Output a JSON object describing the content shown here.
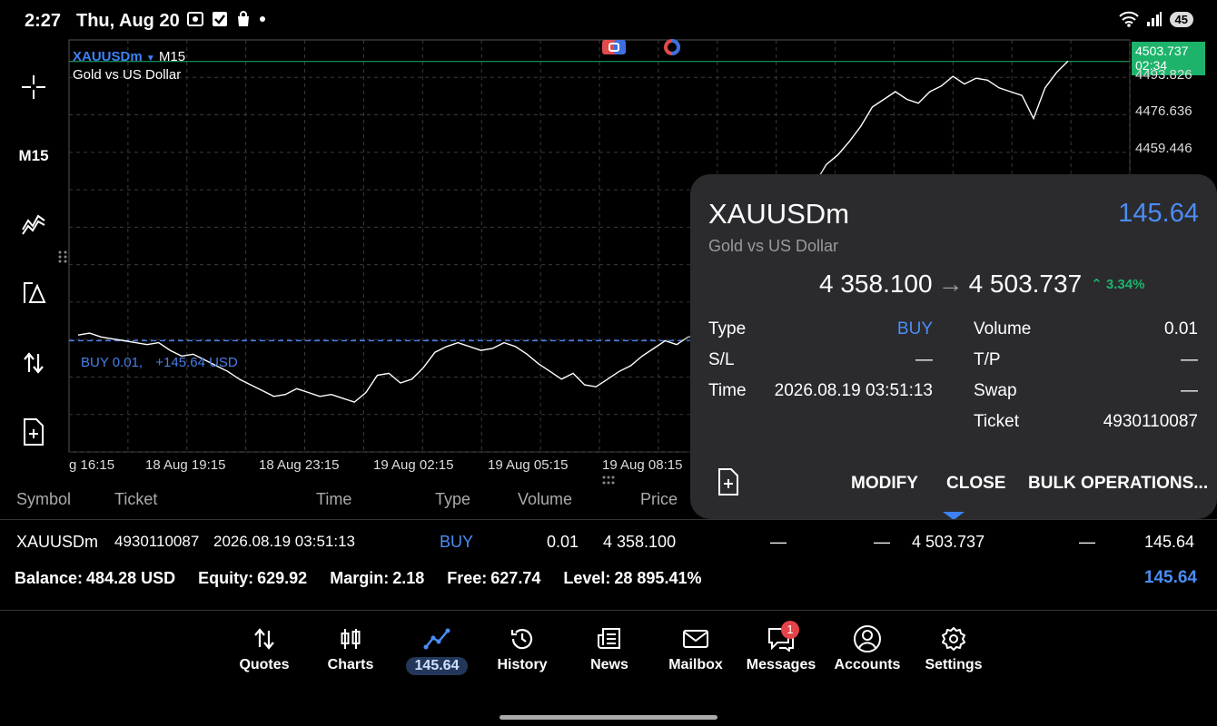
{
  "status_bar": {
    "time": "2:27",
    "date": "Thu, Aug 20",
    "battery": "45"
  },
  "left_toolbar": {
    "timeframe": "M15"
  },
  "chart": {
    "symbol": "XAUUSDm",
    "timeframe": "M15",
    "description": "Gold vs US Dollar",
    "price_tag_price": "4503.737",
    "price_tag_time": "02:34",
    "trade_line_label": "BUY 0.01,",
    "trade_line_profit": "+145.64 USD",
    "colors": {
      "line": "#ffffff",
      "trade_line": "#4a7ee8",
      "price_tag": "#1db36b",
      "grid": "#3a3a3a"
    }
  },
  "chart_data": {
    "type": "line",
    "title": "XAUUSDm M15",
    "subtitle": "Gold vs US Dollar",
    "x_tick_labels": [
      "g 16:15",
      "18 Aug 19:15",
      "18 Aug 23:15",
      "19 Aug 02:15",
      "19 Aug 05:15",
      "19 Aug 08:15"
    ],
    "y_tick_labels": [
      "4493.826",
      "4476.636",
      "4459.446"
    ],
    "current_price": 4503.737,
    "trade_open_price": 4358.1,
    "series": [
      {
        "values": [
          4361,
          4362,
          4360,
          4359,
          4358,
          4357,
          4356,
          4357,
          4353,
          4350,
          4351,
          4348,
          4345,
          4342,
          4338,
          4335,
          4332,
          4329,
          4330,
          4333,
          4331,
          4329,
          4330,
          4328,
          4326,
          4331,
          4340,
          4341,
          4336,
          4338,
          4344,
          4352,
          4355,
          4357,
          4355,
          4353,
          4354,
          4357,
          4355,
          4351,
          4346,
          4342,
          4338,
          4341,
          4335,
          4334,
          4338,
          4342,
          4345,
          4350,
          4354,
          4358,
          4356,
          4360,
          4361,
          4362,
          4358,
          4359,
          4362,
          4368,
          4380,
          4395,
          4410,
          4425,
          4440,
          4450,
          4455,
          4462,
          4470,
          4480,
          4484,
          4488,
          4484,
          4482,
          4488,
          4491,
          4496,
          4492,
          4495,
          4494,
          4490,
          4488,
          4486,
          4474,
          4490,
          4498,
          4504
        ]
      }
    ]
  },
  "popup": {
    "symbol": "XAUUSDm",
    "description": "Gold vs US Dollar",
    "profit": "145.64",
    "open_price": "4 358.100",
    "current_price": "4 503.737",
    "change_pct": "3.34%",
    "type_label": "Type",
    "type_value": "BUY",
    "sl_label": "S/L",
    "sl_value": "—",
    "time_label": "Time",
    "time_value": "2026.08.19 03:51:13",
    "volume_label": "Volume",
    "volume_value": "0.01",
    "tp_label": "T/P",
    "tp_value": "—",
    "swap_label": "Swap",
    "swap_value": "—",
    "ticket_label": "Ticket",
    "ticket_value": "4930110087",
    "modify": "MODIFY",
    "close": "CLOSE",
    "bulk": "BULK OPERATIONS..."
  },
  "table": {
    "headers": [
      "Symbol",
      "Ticket",
      "Time",
      "Type",
      "Volume",
      "Price"
    ],
    "row": {
      "symbol": "XAUUSDm",
      "ticket": "4930110087",
      "time": "2026.08.19 03:51:13",
      "type": "BUY",
      "volume": "0.01",
      "price": "4 358.100",
      "sl": "—",
      "tp": "—",
      "current": "4 503.737",
      "swap": "—",
      "profit": "145.64"
    }
  },
  "summary": {
    "balance_label": "Balance:",
    "balance": "484.28 USD",
    "equity_label": "Equity:",
    "equity": "629.92",
    "margin_label": "Margin:",
    "margin": "2.18",
    "free_label": "Free:",
    "free": "627.74",
    "level_label": "Level:",
    "level": "28 895.41%",
    "profit": "145.64"
  },
  "nav": {
    "quotes": "Quotes",
    "charts": "Charts",
    "trade": "145.64",
    "history": "History",
    "news": "News",
    "mailbox": "Mailbox",
    "messages": "Messages",
    "messages_badge": "1",
    "accounts": "Accounts",
    "settings": "Settings"
  }
}
